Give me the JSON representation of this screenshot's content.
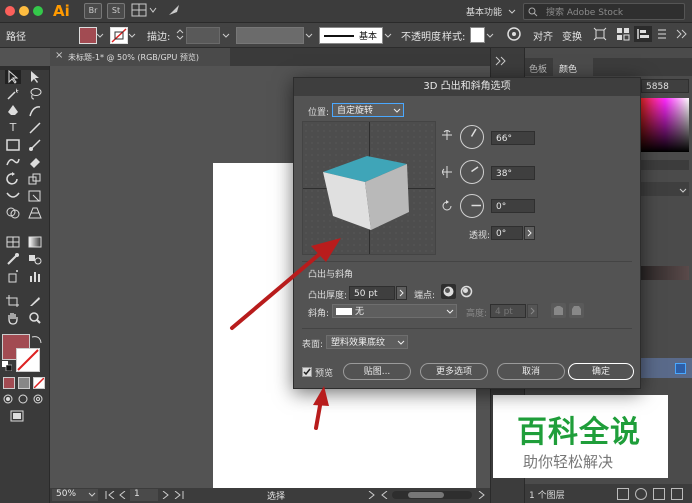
{
  "app": {
    "logo": "Ai",
    "br_label": "Br",
    "st_label": "St",
    "workspace": "基本功能",
    "search_placeholder": "搜索 Adobe Stock"
  },
  "control_bar": {
    "object_type": "路径",
    "stroke_label": "描边:",
    "brush_label": "基本",
    "opacity_label": "不透明度",
    "style_label": "样式:",
    "align_label": "对齐",
    "transform_label": "变换"
  },
  "document_tab": {
    "title": "未标题-1* @ 50% (RGB/GPU 预览)"
  },
  "right_panel": {
    "tab_swatches": "色板",
    "tab_color": "颜色",
    "hex_value": "5858",
    "layers_count": "1 个图层"
  },
  "status_bar": {
    "zoom": "50%",
    "artboard_number": "1",
    "tool_name": "选择"
  },
  "dialog": {
    "title": "3D 凸出和斜角选项",
    "position_label": "位置:",
    "position_value": "自定旋转",
    "rotation_x": "66°",
    "rotation_y": "38°",
    "rotation_z": "0°",
    "perspective_label": "透视:",
    "perspective_value": "0°",
    "extrude_section": "凸出与斜角",
    "extrude_depth_label": "凸出厚度:",
    "extrude_depth_value": "50 pt",
    "cap_label": "端点:",
    "bevel_label": "斜角:",
    "bevel_value": "无",
    "height_label": "高度:",
    "height_value": "4 pt",
    "surface_label": "表面:",
    "surface_value": "塑料效果底纹",
    "preview_label": "预览",
    "map_button": "贴图...",
    "more_options_button": "更多选项",
    "cancel_button": "取消",
    "ok_button": "确定"
  },
  "watermark": {
    "title": "百科全说",
    "subtitle": "助你轻松解决"
  },
  "colors": {
    "fill_swatch": "#a24b52",
    "cube_top": "#3fa5b8",
    "arrow": "#b81c1c",
    "watermark_green": "#1f9e3a"
  }
}
